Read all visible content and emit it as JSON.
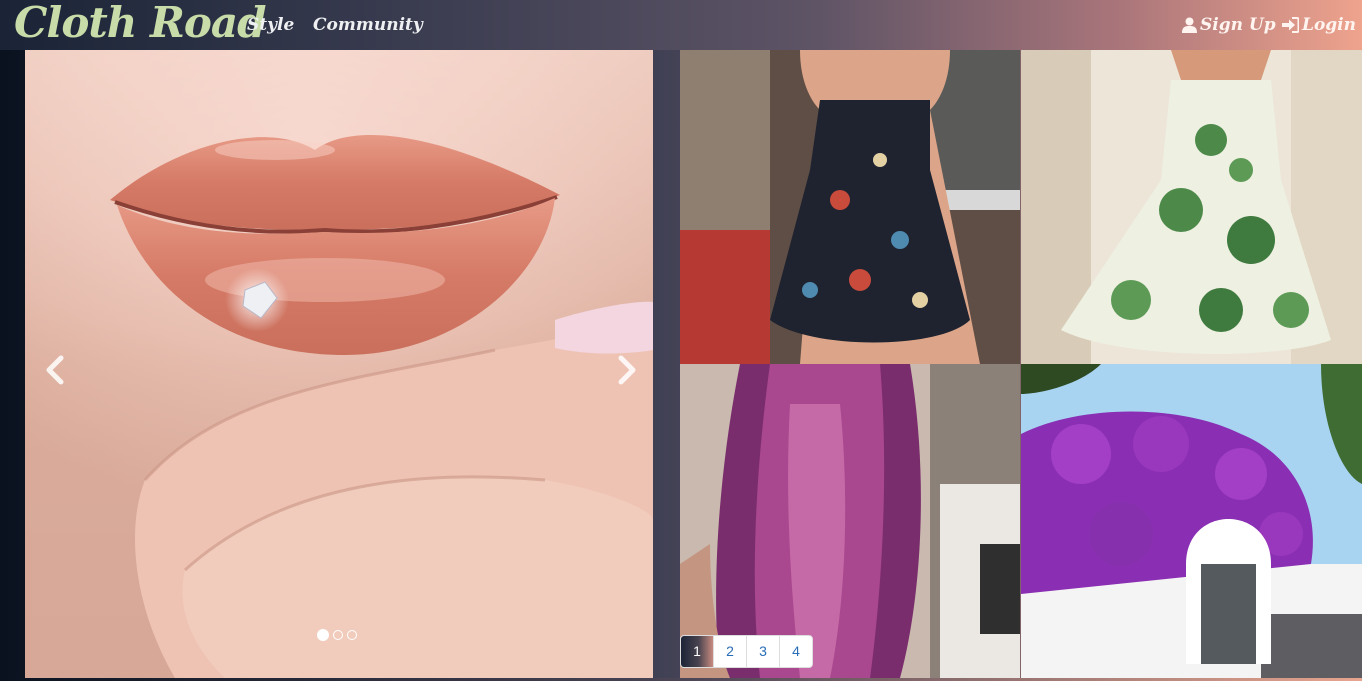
{
  "navbar": {
    "brand": "Cloth Road",
    "links": {
      "style": "Style",
      "community": "Community"
    },
    "account": {
      "signup": "Sign Up",
      "login": "Login",
      "signup_icon": "user-icon",
      "login_icon": "sign-in-icon"
    }
  },
  "carousel": {
    "slide_count": 3,
    "active_slide": 1,
    "prev_icon": "chevron-left-icon",
    "next_icon": "chevron-right-icon"
  },
  "gallery": {
    "tiles": [
      "dark-floral-dress",
      "green-floral-dress",
      "purple-hair",
      "bougainvillea-gate"
    ]
  },
  "pagination": {
    "pages": [
      "1",
      "2",
      "3",
      "4"
    ],
    "active": "1"
  },
  "colors": {
    "brand": "#c7dca8",
    "link_blue": "#2a6db7",
    "gradient_left": "#1a2436",
    "gradient_right": "#eea38d"
  }
}
